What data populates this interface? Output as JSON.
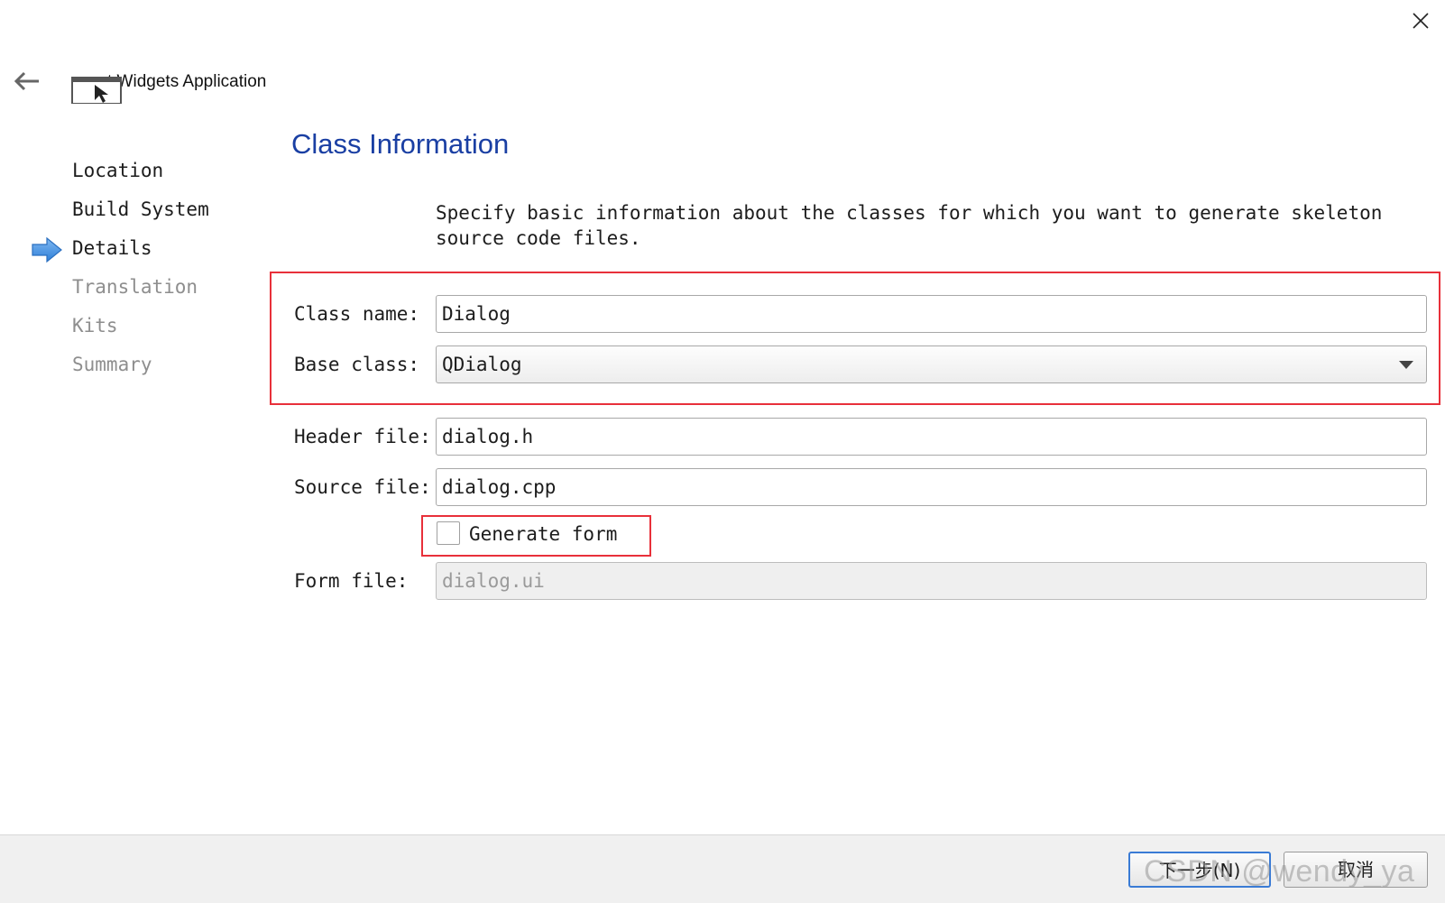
{
  "header": {
    "close_icon": "close-icon",
    "back_icon": "back-arrow-icon",
    "app_icon": "application-window-icon",
    "wizard_title": "t Widgets Application"
  },
  "steps": {
    "items": [
      {
        "label": "Location",
        "state": "done"
      },
      {
        "label": "Build System",
        "state": "done"
      },
      {
        "label": "Details",
        "state": "current"
      },
      {
        "label": "Translation",
        "state": "pending"
      },
      {
        "label": "Kits",
        "state": "pending"
      },
      {
        "label": "Summary",
        "state": "pending"
      }
    ],
    "current_indicator_icon": "right-arrow-icon"
  },
  "main": {
    "title": "Class Information",
    "description": "Specify basic information about the classes for which you want to generate skeleton source code files.",
    "class_name": {
      "label": "Class name:",
      "value": "Dialog"
    },
    "base_class": {
      "label": "Base class:",
      "value": "QDialog"
    },
    "header_file": {
      "label": "Header file:",
      "value": "dialog.h"
    },
    "source_file": {
      "label": "Source file:",
      "value": "dialog.cpp"
    },
    "generate_form": {
      "label": "Generate form",
      "checked": false
    },
    "form_file": {
      "label": "Form file:",
      "value": "dialog.ui",
      "disabled": true
    }
  },
  "footer": {
    "next_label": "下一步(N)",
    "cancel_label": "取消",
    "watermark": "CSDN @wendy_ya"
  },
  "colors": {
    "title_blue": "#1a3fa3",
    "highlight_red": "#e8303a",
    "arrow_blue": "#3a8ee6",
    "default_button_border": "#3a7bd5"
  }
}
